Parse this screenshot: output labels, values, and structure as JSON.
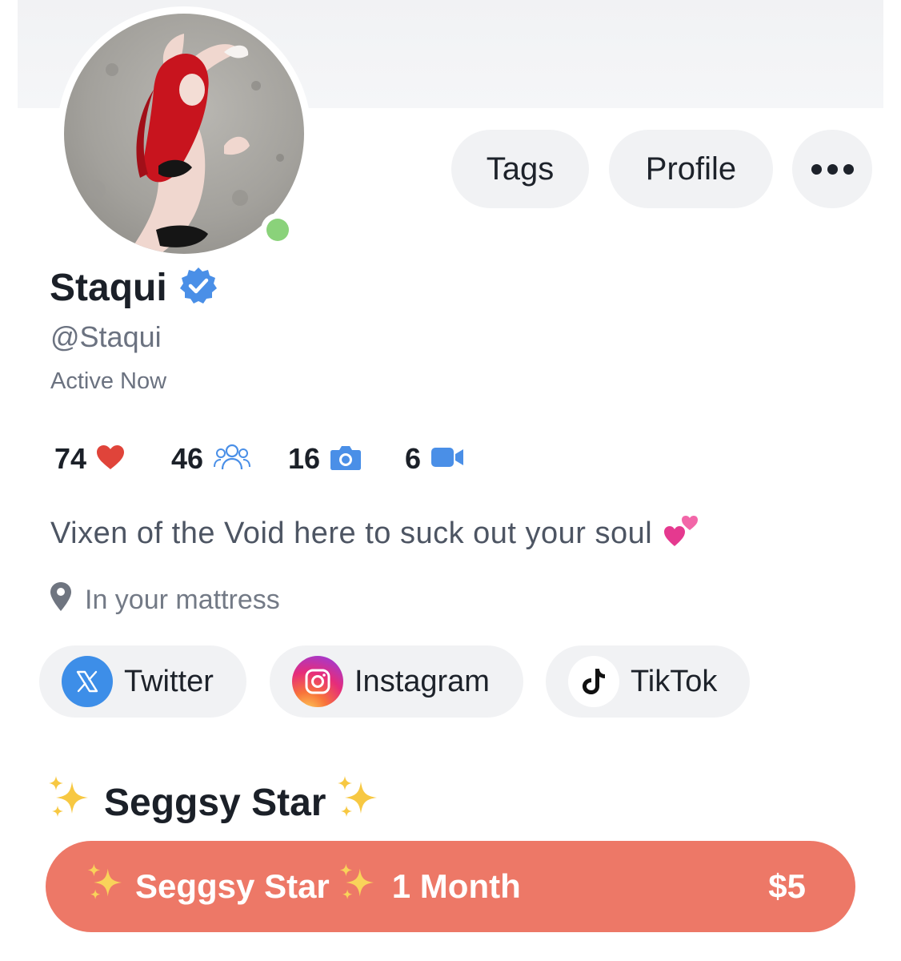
{
  "profile": {
    "name": "Staqui",
    "handle": "@Staqui",
    "status": "Active Now",
    "verified": true,
    "online_color": "#8ad27a"
  },
  "header_actions": {
    "tags_label": "Tags",
    "profile_label": "Profile",
    "more_icon": "more-horizontal-icon"
  },
  "stats": {
    "likes": "74",
    "fans": "46",
    "photos": "16",
    "videos": "6"
  },
  "bio": {
    "text": "Vixen of the Void here to suck out your soul",
    "emoji": "two-hearts-icon"
  },
  "location": {
    "text": "In your mattress"
  },
  "socials": [
    {
      "label": "Twitter",
      "icon": "x-logo-icon",
      "color": "#3d8ee8"
    },
    {
      "label": "Instagram",
      "icon": "instagram-logo-icon"
    },
    {
      "label": "TikTok",
      "icon": "tiktok-logo-icon"
    }
  ],
  "subscription": {
    "heading": "Seggsy Star",
    "tier_name": "Seggsy Star",
    "duration": "1 Month",
    "price": "$5",
    "button_color": "#ed7867"
  },
  "colors": {
    "accent_blue": "#4a8fe7",
    "heart_red": "#e0443a",
    "pill_bg": "#f1f2f4"
  }
}
